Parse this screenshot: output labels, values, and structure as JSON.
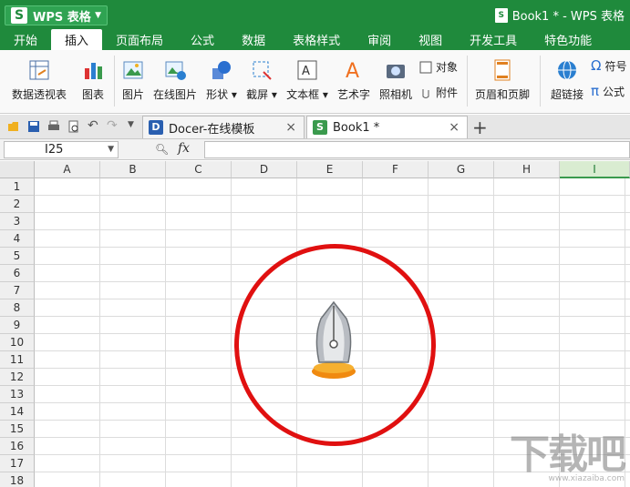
{
  "app": {
    "name": "WPS 表格",
    "logo_letter": "S",
    "window_title": "Book1 * - WPS 表格"
  },
  "menu": [
    {
      "label": "开始"
    },
    {
      "label": "插入"
    },
    {
      "label": "页面布局"
    },
    {
      "label": "公式"
    },
    {
      "label": "数据"
    },
    {
      "label": "表格样式"
    },
    {
      "label": "审阅"
    },
    {
      "label": "视图"
    },
    {
      "label": "开发工具"
    },
    {
      "label": "特色功能"
    }
  ],
  "menu_active": "插入",
  "ribbon": {
    "pivot": "数据透视表",
    "chart": "图表",
    "picture": "图片",
    "online_picture": "在线图片",
    "shapes": "形状",
    "screenshot": "截屏",
    "textbox": "文本框",
    "wordart": "艺术字",
    "camera": "照相机",
    "object": "对象",
    "attachment": "附件",
    "header_footer": "页眉和页脚",
    "hyperlink": "超链接",
    "symbol": "符号",
    "formula": "公式"
  },
  "tabs": [
    {
      "label": "Docer-在线模板",
      "icon": "docer-icon"
    },
    {
      "label": "Book1 *",
      "icon": "xls-icon"
    }
  ],
  "formula_bar": {
    "name_box": "I25",
    "fx": "fx"
  },
  "columns": [
    "A",
    "B",
    "C",
    "D",
    "E",
    "F",
    "G",
    "H",
    "I"
  ],
  "selected_column": "I",
  "rows": [
    "1",
    "2",
    "3",
    "4",
    "5",
    "6",
    "7",
    "8",
    "9",
    "10",
    "11",
    "12",
    "13",
    "14",
    "15",
    "16",
    "17",
    "18"
  ],
  "colors": {
    "brand_green": "#1f8a3c",
    "highlight_red": "#e01010"
  },
  "watermark": {
    "text": "下载吧",
    "url": "www.xiazaiba.com"
  }
}
